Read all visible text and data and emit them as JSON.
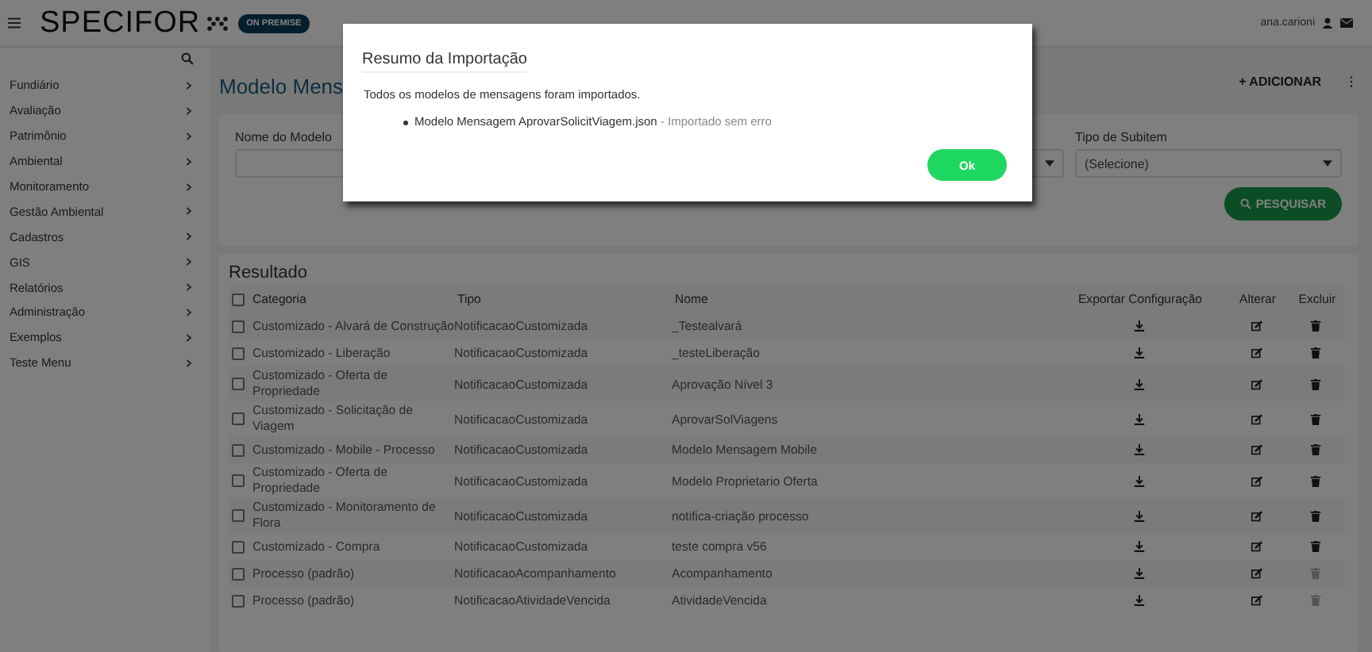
{
  "header": {
    "logo": "SPECIFOR",
    "badge": "ON PREMISE",
    "user": "ana.carioni"
  },
  "sidebar": {
    "items": [
      {
        "label": "Fundiário"
      },
      {
        "label": "Avaliação"
      },
      {
        "label": "Patrimônio"
      },
      {
        "label": "Ambiental"
      },
      {
        "label": "Monitoramento"
      },
      {
        "label": "Gestão Ambiental"
      },
      {
        "label": "Cadastros"
      },
      {
        "label": "GIS"
      },
      {
        "label": "Relatórios"
      },
      {
        "label": "Administração"
      },
      {
        "label": "Exemplos"
      },
      {
        "label": "Teste Menu"
      }
    ]
  },
  "page": {
    "title": "Modelo Mens",
    "add_button": "+ ADICIONAR"
  },
  "filters": {
    "fields": [
      {
        "kind": "text",
        "label": "Nome do Modelo"
      },
      {
        "kind": "select"
      },
      {
        "kind": "select",
        "label": "Tipo de Subitem",
        "value": "(Selecione)"
      }
    ],
    "search_button": "PESQUISAR"
  },
  "results": {
    "title": "Resultado",
    "all_checked": false,
    "columns": [
      "Categoria",
      "Tipo",
      "Nome",
      "Exportar Configuração",
      "Alterar",
      "Excluir"
    ],
    "rows": [
      {
        "checked": false,
        "category": "Customizado - Alvará de Construção",
        "type": "NotificacaoCustomizada",
        "name": "_Testealvará",
        "deletable": true
      },
      {
        "checked": false,
        "category": "Customizado - Liberação",
        "type": "NotificacaoCustomizada",
        "name": "_testeLiberação",
        "deletable": true
      },
      {
        "checked": false,
        "category": "Customizado - Oferta de Propriedade",
        "type": "NotificacaoCustomizada",
        "name": "Aprovação Nível 3",
        "deletable": true
      },
      {
        "checked": false,
        "category": "Customizado - Solicitação de Viagem",
        "type": "NotificacaoCustomizada",
        "name": "AprovarSolViagens",
        "deletable": true
      },
      {
        "checked": false,
        "category": "Customizado - Mobile - Processo",
        "type": "NotificacaoCustomizada",
        "name": "Modelo Mensagem Mobile",
        "deletable": true
      },
      {
        "checked": false,
        "category": "Customizado - Oferta de Propriedade",
        "type": "NotificacaoCustomizada",
        "name": "Modelo Proprietario Oferta",
        "deletable": true
      },
      {
        "checked": false,
        "category": "Customizado - Monitoramento de Flora",
        "type": "NotificacaoCustomizada",
        "name": "notifica-criação processo",
        "deletable": true
      },
      {
        "checked": false,
        "category": "Customizado - Compra",
        "type": "NotificacaoCustomizada",
        "name": "teste compra v56",
        "deletable": true
      },
      {
        "checked": false,
        "category": "Processo (padrão)",
        "type": "NotificacaoAcompanhamento",
        "name": "Acompanhamento",
        "deletable": false
      },
      {
        "checked": false,
        "category": "Processo (padrão)",
        "type": "NotificacaoAtividadeVencida",
        "name": "AtividadeVencida",
        "deletable": false
      }
    ]
  },
  "modal": {
    "title": "Resumo da Importação",
    "message": "Todos os modelos de mensagens foram importados.",
    "items": [
      {
        "file": "Modelo Mensagem AprovarSolicitViagem.json",
        "status": "- Importado sem erro"
      }
    ],
    "button": "Ok"
  }
}
